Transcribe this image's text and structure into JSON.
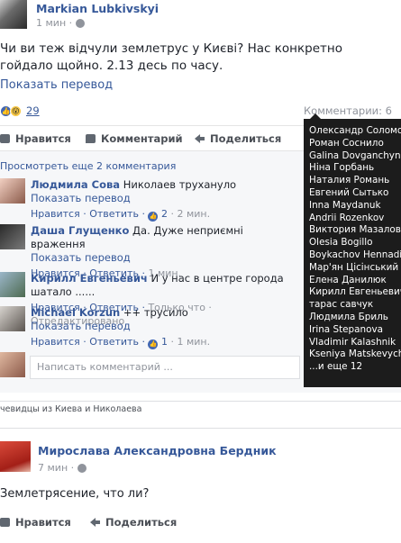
{
  "post": {
    "author": "Markian Lubkivskyi",
    "time": "1 мин ·",
    "text": "Чи ви теж відчули землетрус у Києві? Нас конкретно гойдало щойно. 2.13 десь по часу.",
    "translate": "Показать перевод",
    "reactions_count": "29",
    "comments_count": "Комментарии: 6",
    "actions": {
      "like": "Нравится",
      "comment": "Комментарий",
      "share": "Поделиться"
    }
  },
  "comments": {
    "prev_link": "Просмотреть еще 2 комментария",
    "items": [
      {
        "name": "Людмила Сова",
        "text": " Николаев трухануло",
        "translate": "Показать перевод",
        "reply": "Нравится · Ответить · ",
        "likes": "2",
        "time": " · 2 мин."
      },
      {
        "name": "Даша Глущенко",
        "text": " Да. Дуже неприємні враження",
        "translate": "Показать перевод",
        "reply": "Нравится · Ответить · ",
        "likes": "",
        "time": "1 мин."
      },
      {
        "name": "Кирилл Евгеньевич",
        "text": " И у нас в центре города шатало ......",
        "translate": "",
        "reply": "Нравится · Ответить · ",
        "likes": "",
        "time": "Только что · Отредактировано"
      },
      {
        "name": "Michael Korzun",
        "text": " ++ трусило",
        "translate": "Показать перевод",
        "reply": "Нравится · Ответить · ",
        "likes": "1",
        "time": " · 1 мин."
      }
    ],
    "write_placeholder": "Написать комментарий ..."
  },
  "tooltip": {
    "names": [
      "Олександр Соломон",
      "Роман Соснило",
      "Galina Dovganchyn",
      "Ніна Горбань",
      "Наталия Романь",
      "Евгений Сытько",
      "Inna Maydanuk",
      "Andrii Rozenkov",
      "Виктория Мазалова",
      "Olesia Bogillo",
      "Boykachov Hennadii",
      "Мар'ян Цісінський",
      "Елена Данилюк",
      "Кирилл Евгеньевич",
      "тарас савчук",
      "Людмила Бриль",
      "Irina Stepanova",
      "Vladimir Kalashnik",
      "Kseniya Matskevych",
      "...и еще 12"
    ]
  },
  "caption": "чевидцы из Киева и Николаева",
  "post2": {
    "author": "Мирослава Александровна Бердник",
    "time": "7 мин ·",
    "text": "Землетрясение, что ли?",
    "actions": {
      "like": "Нравится",
      "share": "Поделиться"
    }
  }
}
